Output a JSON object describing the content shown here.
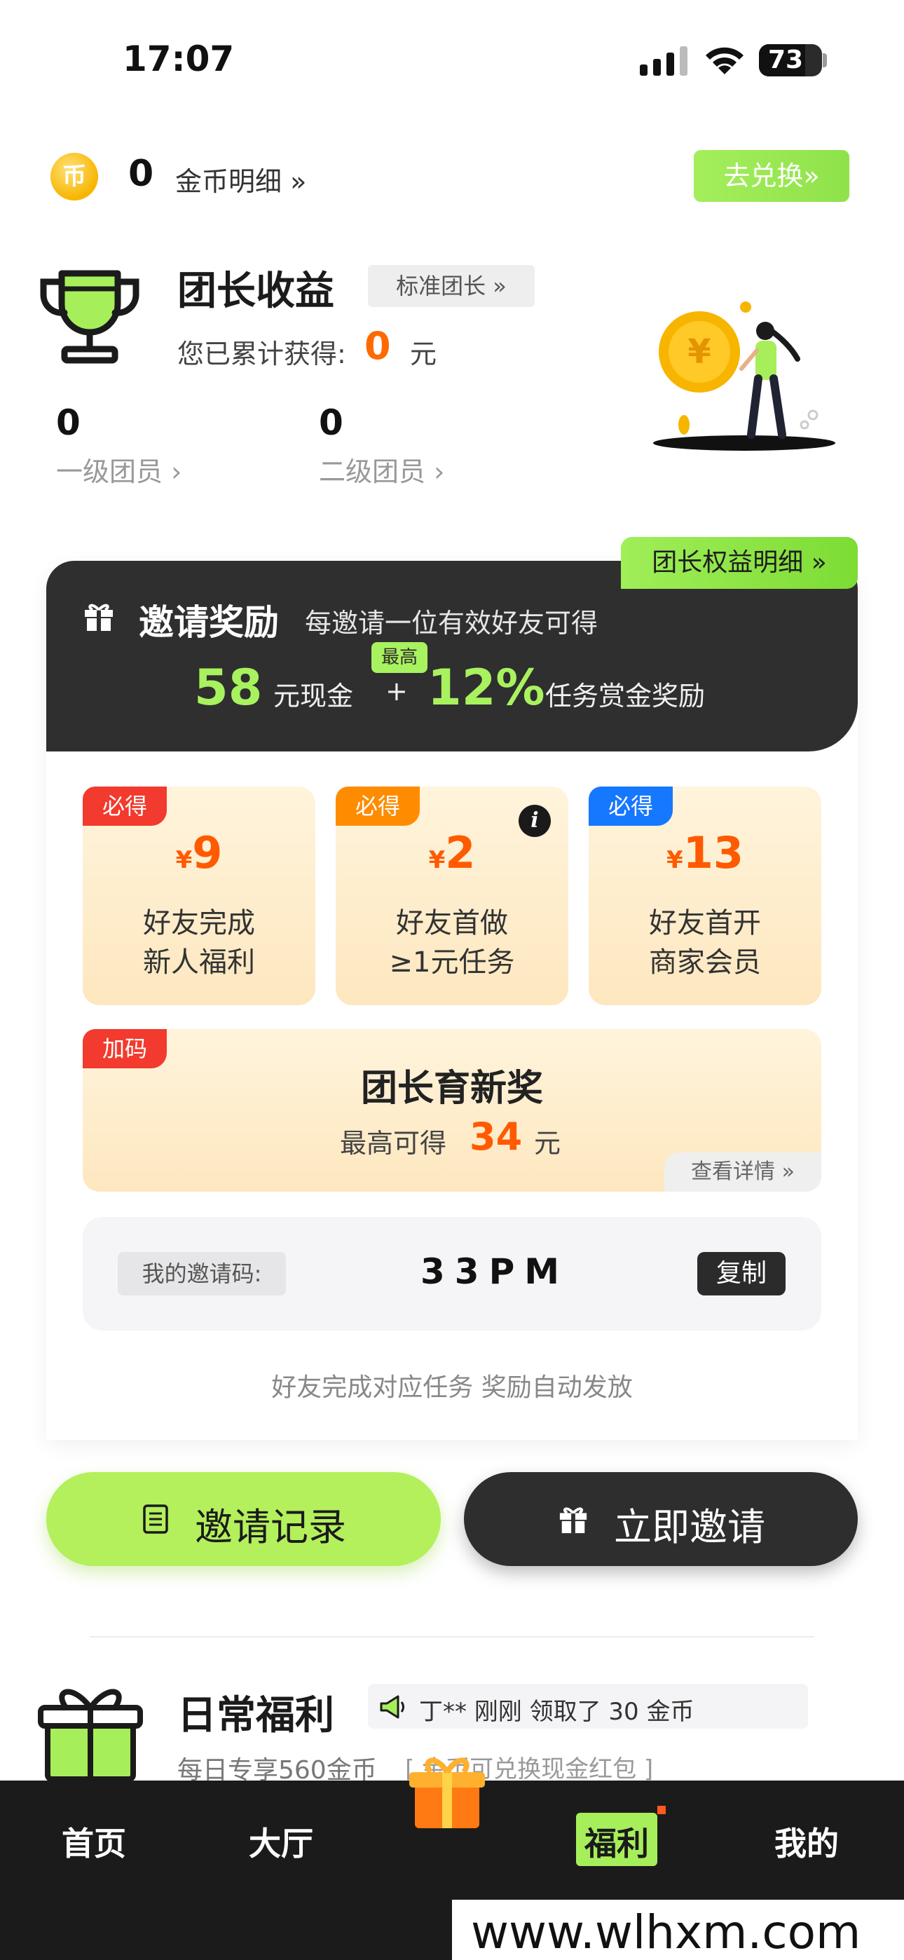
{
  "status_bar": {
    "time": "17:07",
    "battery": "73"
  },
  "coins": {
    "count": "0",
    "detail_label": "金币明细 »",
    "exchange_label": "去兑换»",
    "coin_glyph": "币"
  },
  "leader": {
    "title": "团长收益",
    "level_label": "标准团长 »",
    "earned_label": "您已累计获得:",
    "earned_value": "0",
    "earned_unit": "元",
    "tiers": [
      {
        "count": "0",
        "label": "一级团员 ›"
      },
      {
        "count": "0",
        "label": "二级团员 ›"
      }
    ]
  },
  "invite": {
    "rights_label": "团长权益明细 »",
    "title": "邀请奖励",
    "desc": "每邀请一位有效好友可得",
    "cash_value": "58",
    "cash_label": "元现金",
    "plus": "+",
    "max_tag": "最高",
    "pct_value": "12%",
    "pct_label": "任务赏金奖励"
  },
  "rewards": [
    {
      "tag": "必得",
      "tag_color": "#f23a2e",
      "yen": "¥",
      "amount": "9",
      "line1": "好友完成",
      "line2": "新人福利"
    },
    {
      "tag": "必得",
      "tag_color": "#ff8c00",
      "yen": "¥",
      "amount": "2",
      "line1": "好友首做",
      "line2": "≥1元任务"
    },
    {
      "tag": "必得",
      "tag_color": "#1677ff",
      "yen": "¥",
      "amount": "13",
      "line1": "好友首开",
      "line2": "商家会员"
    }
  ],
  "bonus": {
    "tag": "加码",
    "title": "团长育新奖",
    "line": "最高可得",
    "value": "34",
    "unit": "元",
    "detail_label": "查看详情 »"
  },
  "invite_code": {
    "label": "我的邀请码:",
    "value": "33PM",
    "copy_label": "复制"
  },
  "auto_note": "好友完成对应任务 奖励自动发放",
  "actions": {
    "record_label": "邀请记录",
    "invite_label": "立即邀请"
  },
  "daily": {
    "title": "日常福利",
    "marquee": "丁** 刚刚 领取了 30 金币",
    "subtitle": "每日专享560金币",
    "subtitle_note": "[ 金币可兑换现金红包 ]"
  },
  "tabs": [
    {
      "label": "首页"
    },
    {
      "label": "大厅"
    },
    {
      "label": "福利"
    },
    {
      "label": "我的"
    }
  ],
  "watermark": "www.wlhxm.com",
  "colors": {
    "accent_green": "#a6ef5a",
    "orange": "#ff6a00",
    "dark": "#2f2f2f"
  }
}
